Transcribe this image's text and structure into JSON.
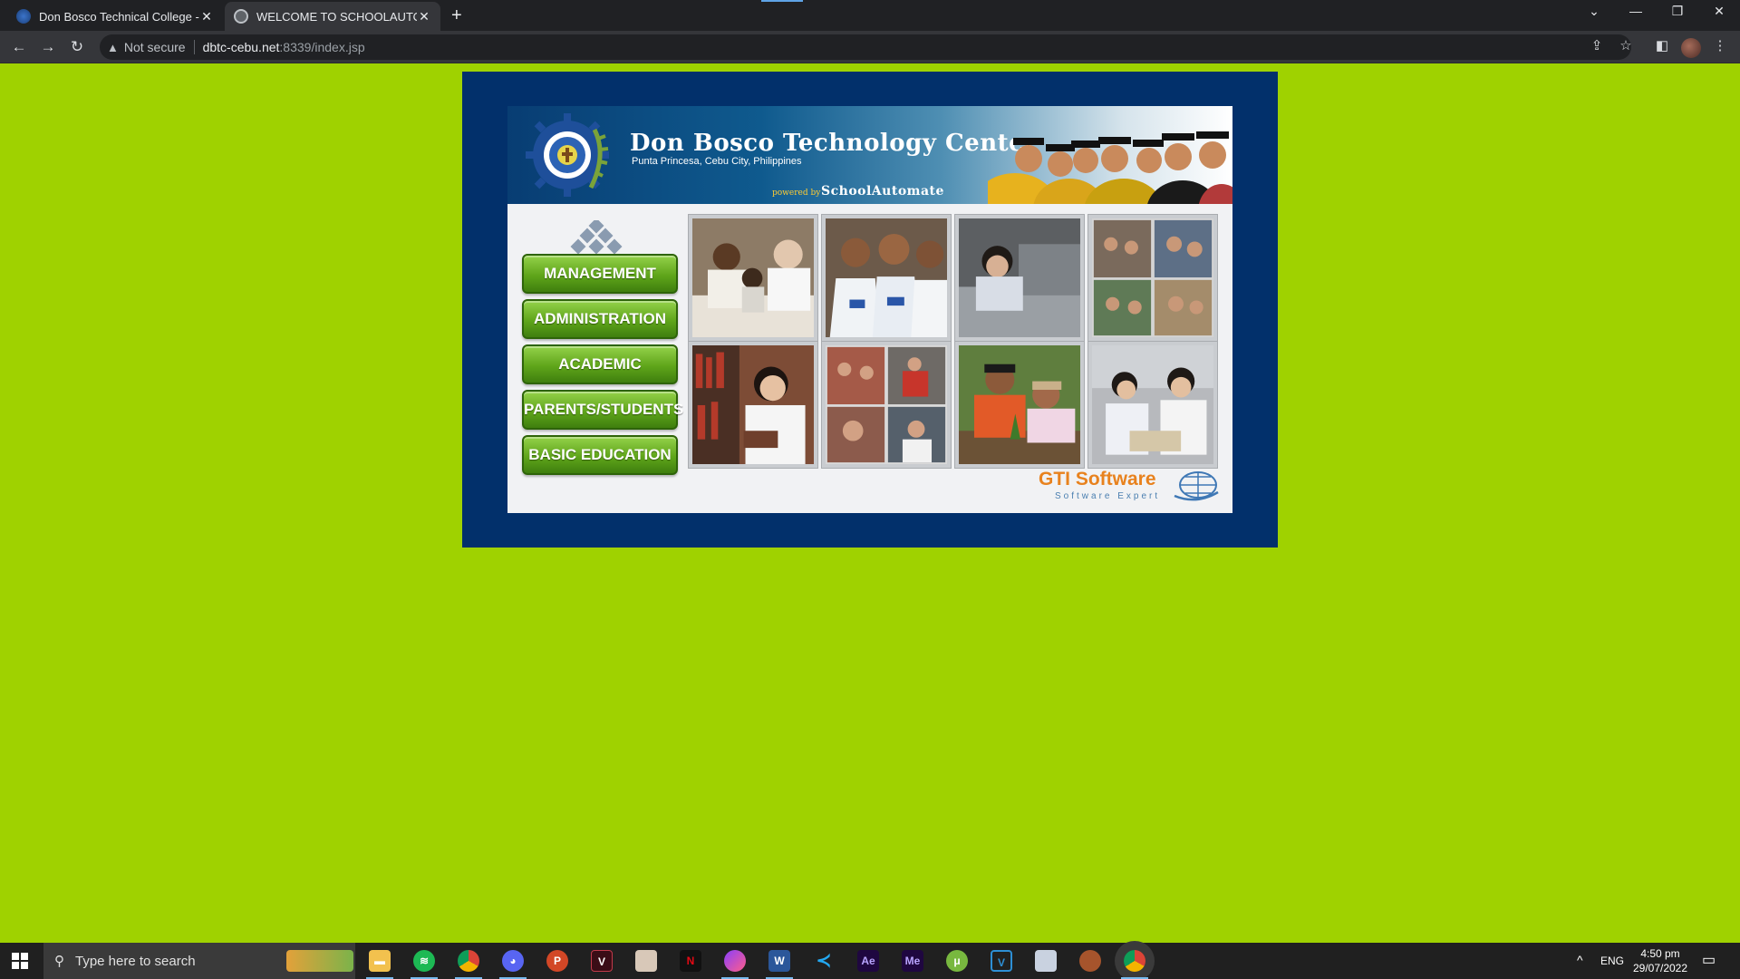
{
  "browser": {
    "tabs": [
      {
        "title": "Don Bosco Technical College - C",
        "active": false
      },
      {
        "title": "WELCOME TO SCHOOLAUTOMA",
        "active": true
      }
    ],
    "new_tab": "+",
    "address": {
      "security": "Not secure",
      "host": "dbtc-cebu.net",
      "path": ":8339/index.jsp"
    },
    "window_controls": {
      "minimize": "—",
      "restore": "❐",
      "close": "✕",
      "tab_search": "⌄"
    }
  },
  "page": {
    "background_color": "#9fd200",
    "frame_color": "#02306b",
    "banner": {
      "school_name": "Don Bosco Technology Center",
      "address": "Punta Princesa, Cebu City, Philippines",
      "powered_by": "powered by",
      "platform": "SchoolAutomate"
    },
    "menu": [
      {
        "label": "MANAGEMENT"
      },
      {
        "label": "ADMINISTRATION"
      },
      {
        "label": "ACADEMIC"
      },
      {
        "label": "PARENTS/STUDENTS"
      },
      {
        "label": "BASIC EDUCATION"
      }
    ],
    "photos": [
      {
        "name": "mentor-workshop-photo"
      },
      {
        "name": "students-uniform-photo"
      },
      {
        "name": "lab-machine-photo"
      },
      {
        "name": "student-collage-photo"
      },
      {
        "name": "library-student-photo"
      },
      {
        "name": "community-collage-photo"
      },
      {
        "name": "tree-planting-photo"
      },
      {
        "name": "study-group-photo"
      }
    ],
    "vendor": {
      "name": "GTI Software",
      "tagline": "Software Expert"
    },
    "colors": {
      "menu_green": "#5fa51a",
      "vendor_orange": "#e8821e"
    }
  },
  "taskbar": {
    "search_placeholder": "Type here to search",
    "apps": [
      "File Explorer",
      "Spotify",
      "Chrome",
      "Discord",
      "PowerPoint",
      "App",
      "App",
      "Netflix",
      "Messenger",
      "Word",
      "VS Code",
      "After Effects",
      "Media Encoder",
      "uTorrent",
      "Vegas",
      "App",
      "App",
      "Chrome"
    ],
    "language": "ENG",
    "time": "4:50 pm",
    "date": "29/07/2022"
  }
}
